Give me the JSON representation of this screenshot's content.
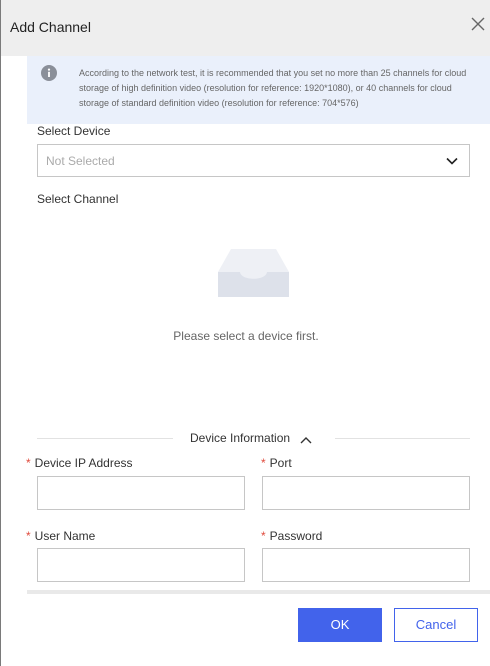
{
  "dialog": {
    "title": "Add Channel"
  },
  "notice": {
    "icon": "info-icon",
    "text": "According to the network test, it is recommended that you set no more than 25 channels for cloud storage of high definition video (resolution for reference: 1920*1080), or 40 channels for cloud storage of standard definition video (resolution for reference: 704*576)"
  },
  "device_select": {
    "label": "Select Device",
    "placeholder": "Not Selected"
  },
  "channel_select": {
    "label": "Select Channel",
    "empty_text": "Please select a device first."
  },
  "device_info": {
    "section_title": "Device Information",
    "required_mark": "*",
    "ip_label": "Device IP Address",
    "ip_value": "",
    "port_label": "Port",
    "port_value": "",
    "username_label": "User Name",
    "username_value": "",
    "password_label": "Password",
    "password_value": ""
  },
  "footer": {
    "ok_label": "OK",
    "cancel_label": "Cancel"
  },
  "colors": {
    "primary": "#4263eb",
    "required": "#e04b3d",
    "notice_bg": "#eaf0fb"
  }
}
